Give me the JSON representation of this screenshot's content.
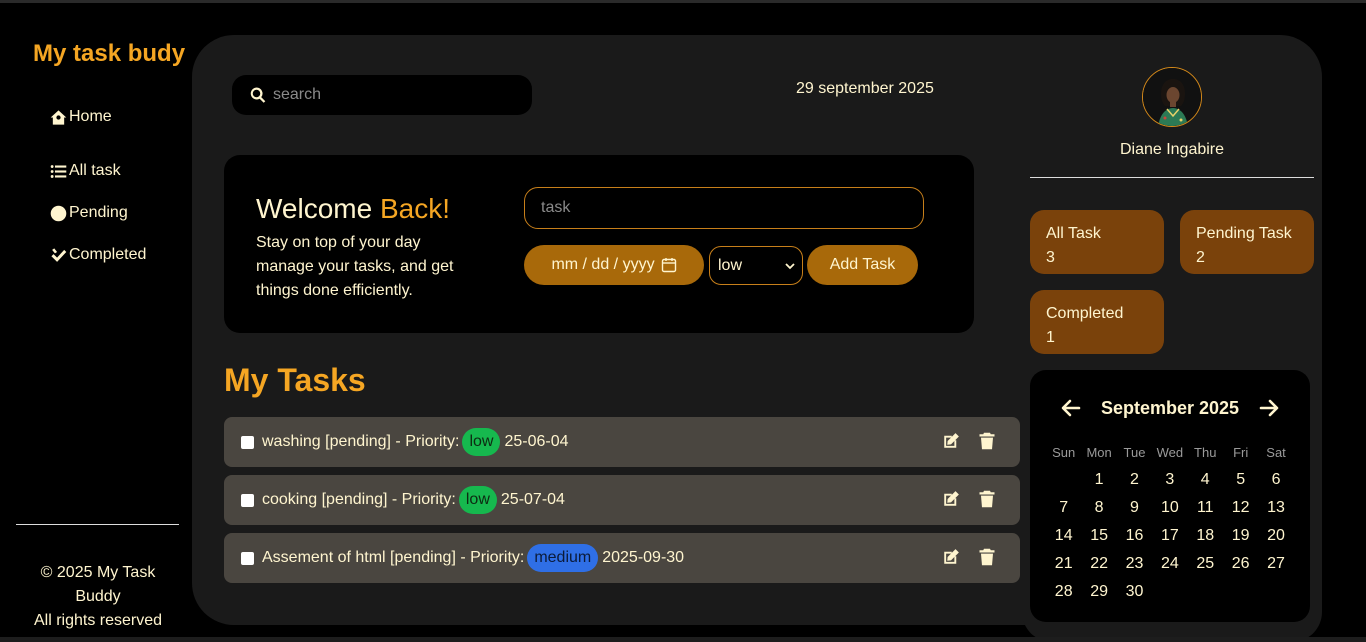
{
  "sidebar": {
    "brand": "My task budy",
    "items": [
      {
        "label": "Home",
        "icon": "home-icon"
      },
      {
        "label": "All task",
        "icon": "list-icon"
      },
      {
        "label": "Pending",
        "icon": "clock-icon"
      },
      {
        "label": "Completed",
        "icon": "check-icon"
      }
    ],
    "footer_line1": "© 2025 My Task Buddy",
    "footer_line2": "All rights reserved"
  },
  "header": {
    "search_placeholder": "search",
    "date": "29 september 2025"
  },
  "welcome": {
    "title_plain": "Welcome ",
    "title_accent": "Back!",
    "text": "Stay on top of your day manage your tasks, and get things done efficiently.",
    "task_placeholder": "task",
    "date_placeholder": "mm / dd / yyyy",
    "priority_selected": "low",
    "add_button": "Add Task"
  },
  "tasks": {
    "heading": "My Tasks",
    "items": [
      {
        "text": "washing [pending] - Priority:",
        "priority": "low",
        "date": "25-06-04"
      },
      {
        "text": "cooking [pending] - Priority:",
        "priority": "low",
        "date": "25-07-04"
      },
      {
        "text": "Assement of html [pending] - Priority:",
        "priority": "medium",
        "date": "2025-09-30"
      }
    ]
  },
  "profile": {
    "name": "Diane Ingabire"
  },
  "stats": {
    "all_label": "All Task",
    "all_count": "3",
    "pending_label": "Pending Task",
    "pending_count": "2",
    "completed_label": "Completed",
    "completed_count": "1"
  },
  "calendar": {
    "title": "September 2025",
    "weekdays": [
      "Sun",
      "Mon",
      "Tue",
      "Wed",
      "Thu",
      "Fri",
      "Sat"
    ],
    "first_weekday_index": 1,
    "days": [
      "1",
      "2",
      "3",
      "4",
      "5",
      "6",
      "7",
      "8",
      "9",
      "10",
      "11",
      "12",
      "13",
      "14",
      "15",
      "16",
      "17",
      "18",
      "19",
      "20",
      "21",
      "22",
      "23",
      "24",
      "25",
      "26",
      "27",
      "28",
      "29",
      "30"
    ]
  },
  "colors": {
    "accent": "#f5a623",
    "button": "#a8690a",
    "stat_card": "#7a420b",
    "low_badge": "#16b84e",
    "medium_badge": "#2f6fe6"
  }
}
